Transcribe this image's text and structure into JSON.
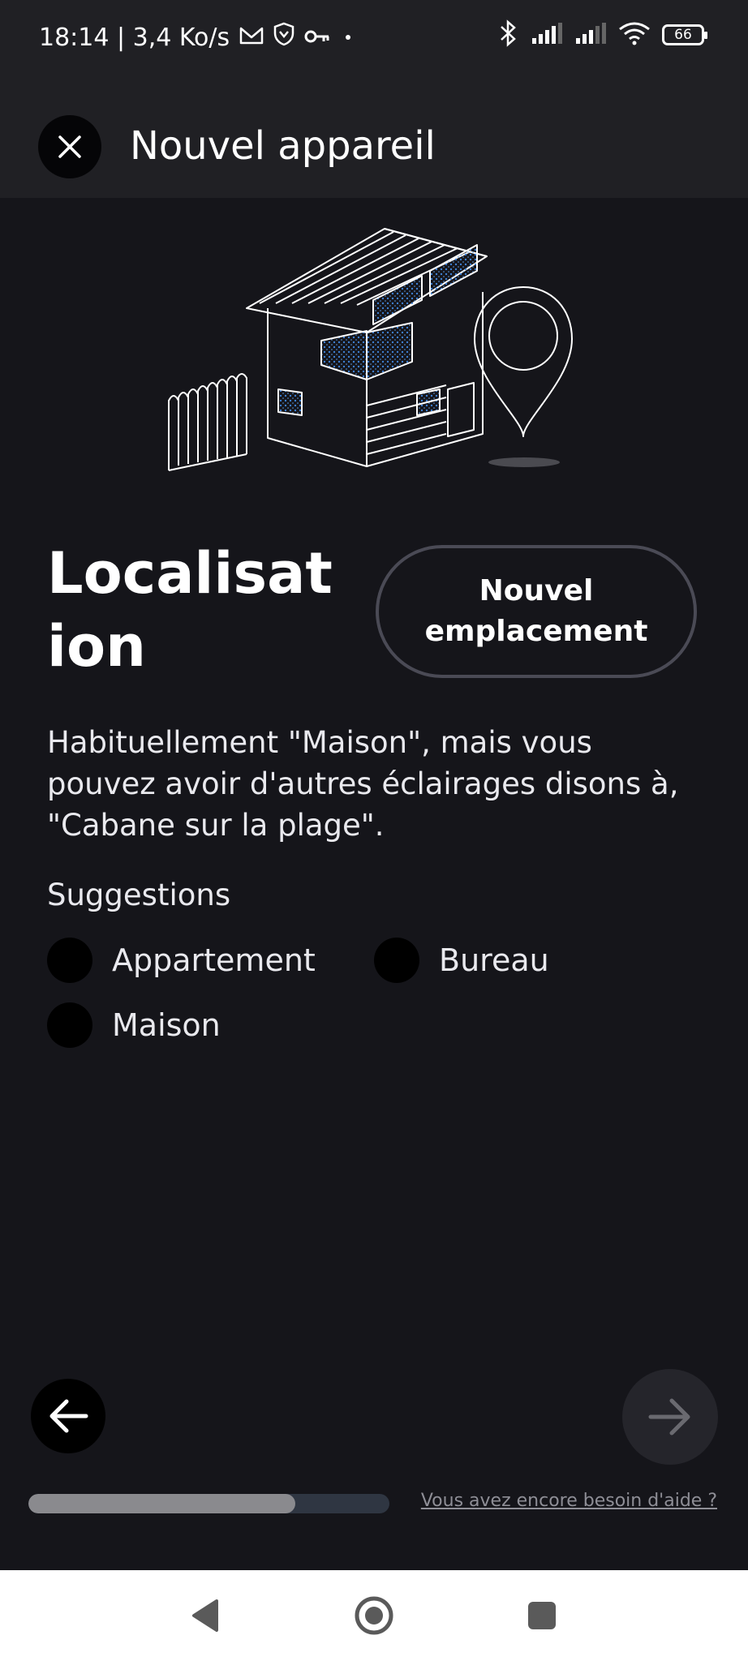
{
  "status_bar": {
    "time_speed": "18:14 | 3,4 Ko/s",
    "battery": "66",
    "icons": [
      "mail-icon",
      "shield-icon",
      "key-icon",
      "dot-icon",
      "bluetooth-icon",
      "signal-icon",
      "signal-icon",
      "wifi-icon",
      "battery-icon"
    ]
  },
  "header": {
    "title": "Nouvel appareil"
  },
  "main": {
    "title": "Localisation",
    "new_location_button": "Nouvel emplacement",
    "description": "Habituellement \"Maison\", mais vous pouvez avoir d'autres éclairages disons à, \"Cabane sur la plage\".",
    "suggestions_label": "Suggestions",
    "suggestions": [
      {
        "label": "Appartement"
      },
      {
        "label": "Bureau"
      },
      {
        "label": "Maison"
      }
    ]
  },
  "footer": {
    "progress": 0.74,
    "help_link": "Vous avez encore besoin d'aide ?"
  },
  "colors": {
    "background": "#15151a",
    "header": "#202024",
    "progress_track": "#2f3642",
    "progress_fill": "#8a8a8e",
    "accent_dots": "#3d7fd1"
  }
}
